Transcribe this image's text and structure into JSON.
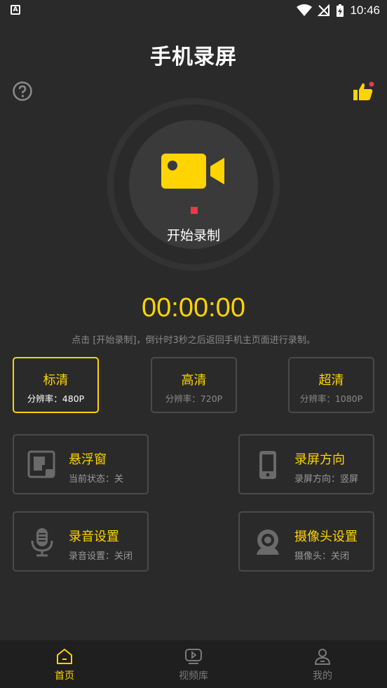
{
  "status_bar": {
    "time": "10:46",
    "app_icon_letter": "A"
  },
  "header": {
    "title": "手机录屏"
  },
  "record": {
    "start_label": "开始录制",
    "timer": "00:00:00",
    "hint": "点击 [开始录制]，倒计时3秒之后返回手机主页面进行录制。"
  },
  "quality": [
    {
      "name": "标清",
      "resolution": "分辨率：480P",
      "selected": true
    },
    {
      "name": "高清",
      "resolution": "分辨率：720P",
      "selected": false
    },
    {
      "name": "超清",
      "resolution": "分辨率：1080P",
      "selected": false
    }
  ],
  "features": [
    {
      "title": "悬浮窗",
      "subtitle": "当前状态：关",
      "icon": "floating-window-icon"
    },
    {
      "title": "录屏方向",
      "subtitle": "录屏方向：竖屏",
      "icon": "phone-icon"
    },
    {
      "title": "录音设置",
      "subtitle": "录音设置：关闭",
      "icon": "microphone-icon"
    },
    {
      "title": "摄像头设置",
      "subtitle": "摄像头：关闭",
      "icon": "webcam-icon"
    }
  ],
  "nav": [
    {
      "label": "首页",
      "icon": "home-icon",
      "active": true
    },
    {
      "label": "视频库",
      "icon": "video-library-icon",
      "active": false
    },
    {
      "label": "我的",
      "icon": "profile-icon",
      "active": false
    }
  ],
  "colors": {
    "accent": "#ffd400",
    "background": "#2a2a2a",
    "record_dot": "#e83a4a"
  }
}
